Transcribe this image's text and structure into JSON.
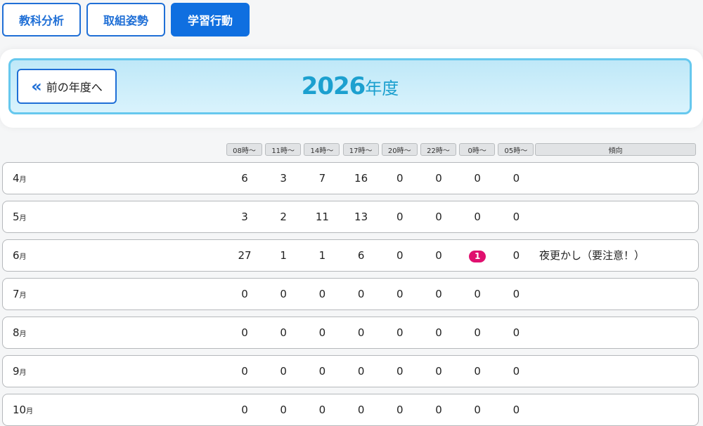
{
  "tabs": [
    {
      "label": "教科分析",
      "active": false
    },
    {
      "label": "取組姿勢",
      "active": false
    },
    {
      "label": "学習行動",
      "active": true
    }
  ],
  "year_nav": {
    "prev_label": "前の年度へ",
    "prev_icon": "double-chevron-left-icon",
    "year": "2026",
    "year_unit": "年度"
  },
  "columns": {
    "hours": [
      "08時～",
      "11時～",
      "14時～",
      "17時～",
      "20時～",
      "22時～",
      "0時～",
      "05時～"
    ],
    "trend": "傾向"
  },
  "month_unit": "月",
  "rows": [
    {
      "month": "4",
      "values": [
        6,
        3,
        7,
        16,
        0,
        0,
        0,
        0
      ],
      "highlight": null,
      "trend": ""
    },
    {
      "month": "5",
      "values": [
        3,
        2,
        11,
        13,
        0,
        0,
        0,
        0
      ],
      "highlight": null,
      "trend": ""
    },
    {
      "month": "6",
      "values": [
        27,
        1,
        1,
        6,
        0,
        0,
        1,
        0
      ],
      "highlight": 6,
      "trend": "夜更かし（要注意！）"
    },
    {
      "month": "7",
      "values": [
        0,
        0,
        0,
        0,
        0,
        0,
        0,
        0
      ],
      "highlight": null,
      "trend": ""
    },
    {
      "month": "8",
      "values": [
        0,
        0,
        0,
        0,
        0,
        0,
        0,
        0
      ],
      "highlight": null,
      "trend": ""
    },
    {
      "month": "9",
      "values": [
        0,
        0,
        0,
        0,
        0,
        0,
        0,
        0
      ],
      "highlight": null,
      "trend": ""
    },
    {
      "month": "10",
      "values": [
        0,
        0,
        0,
        0,
        0,
        0,
        0,
        0
      ],
      "highlight": null,
      "trend": ""
    }
  ],
  "colors": {
    "primary": "#0f6fe0",
    "year_text": "#1ca0cf",
    "alert": "#e0106f"
  }
}
